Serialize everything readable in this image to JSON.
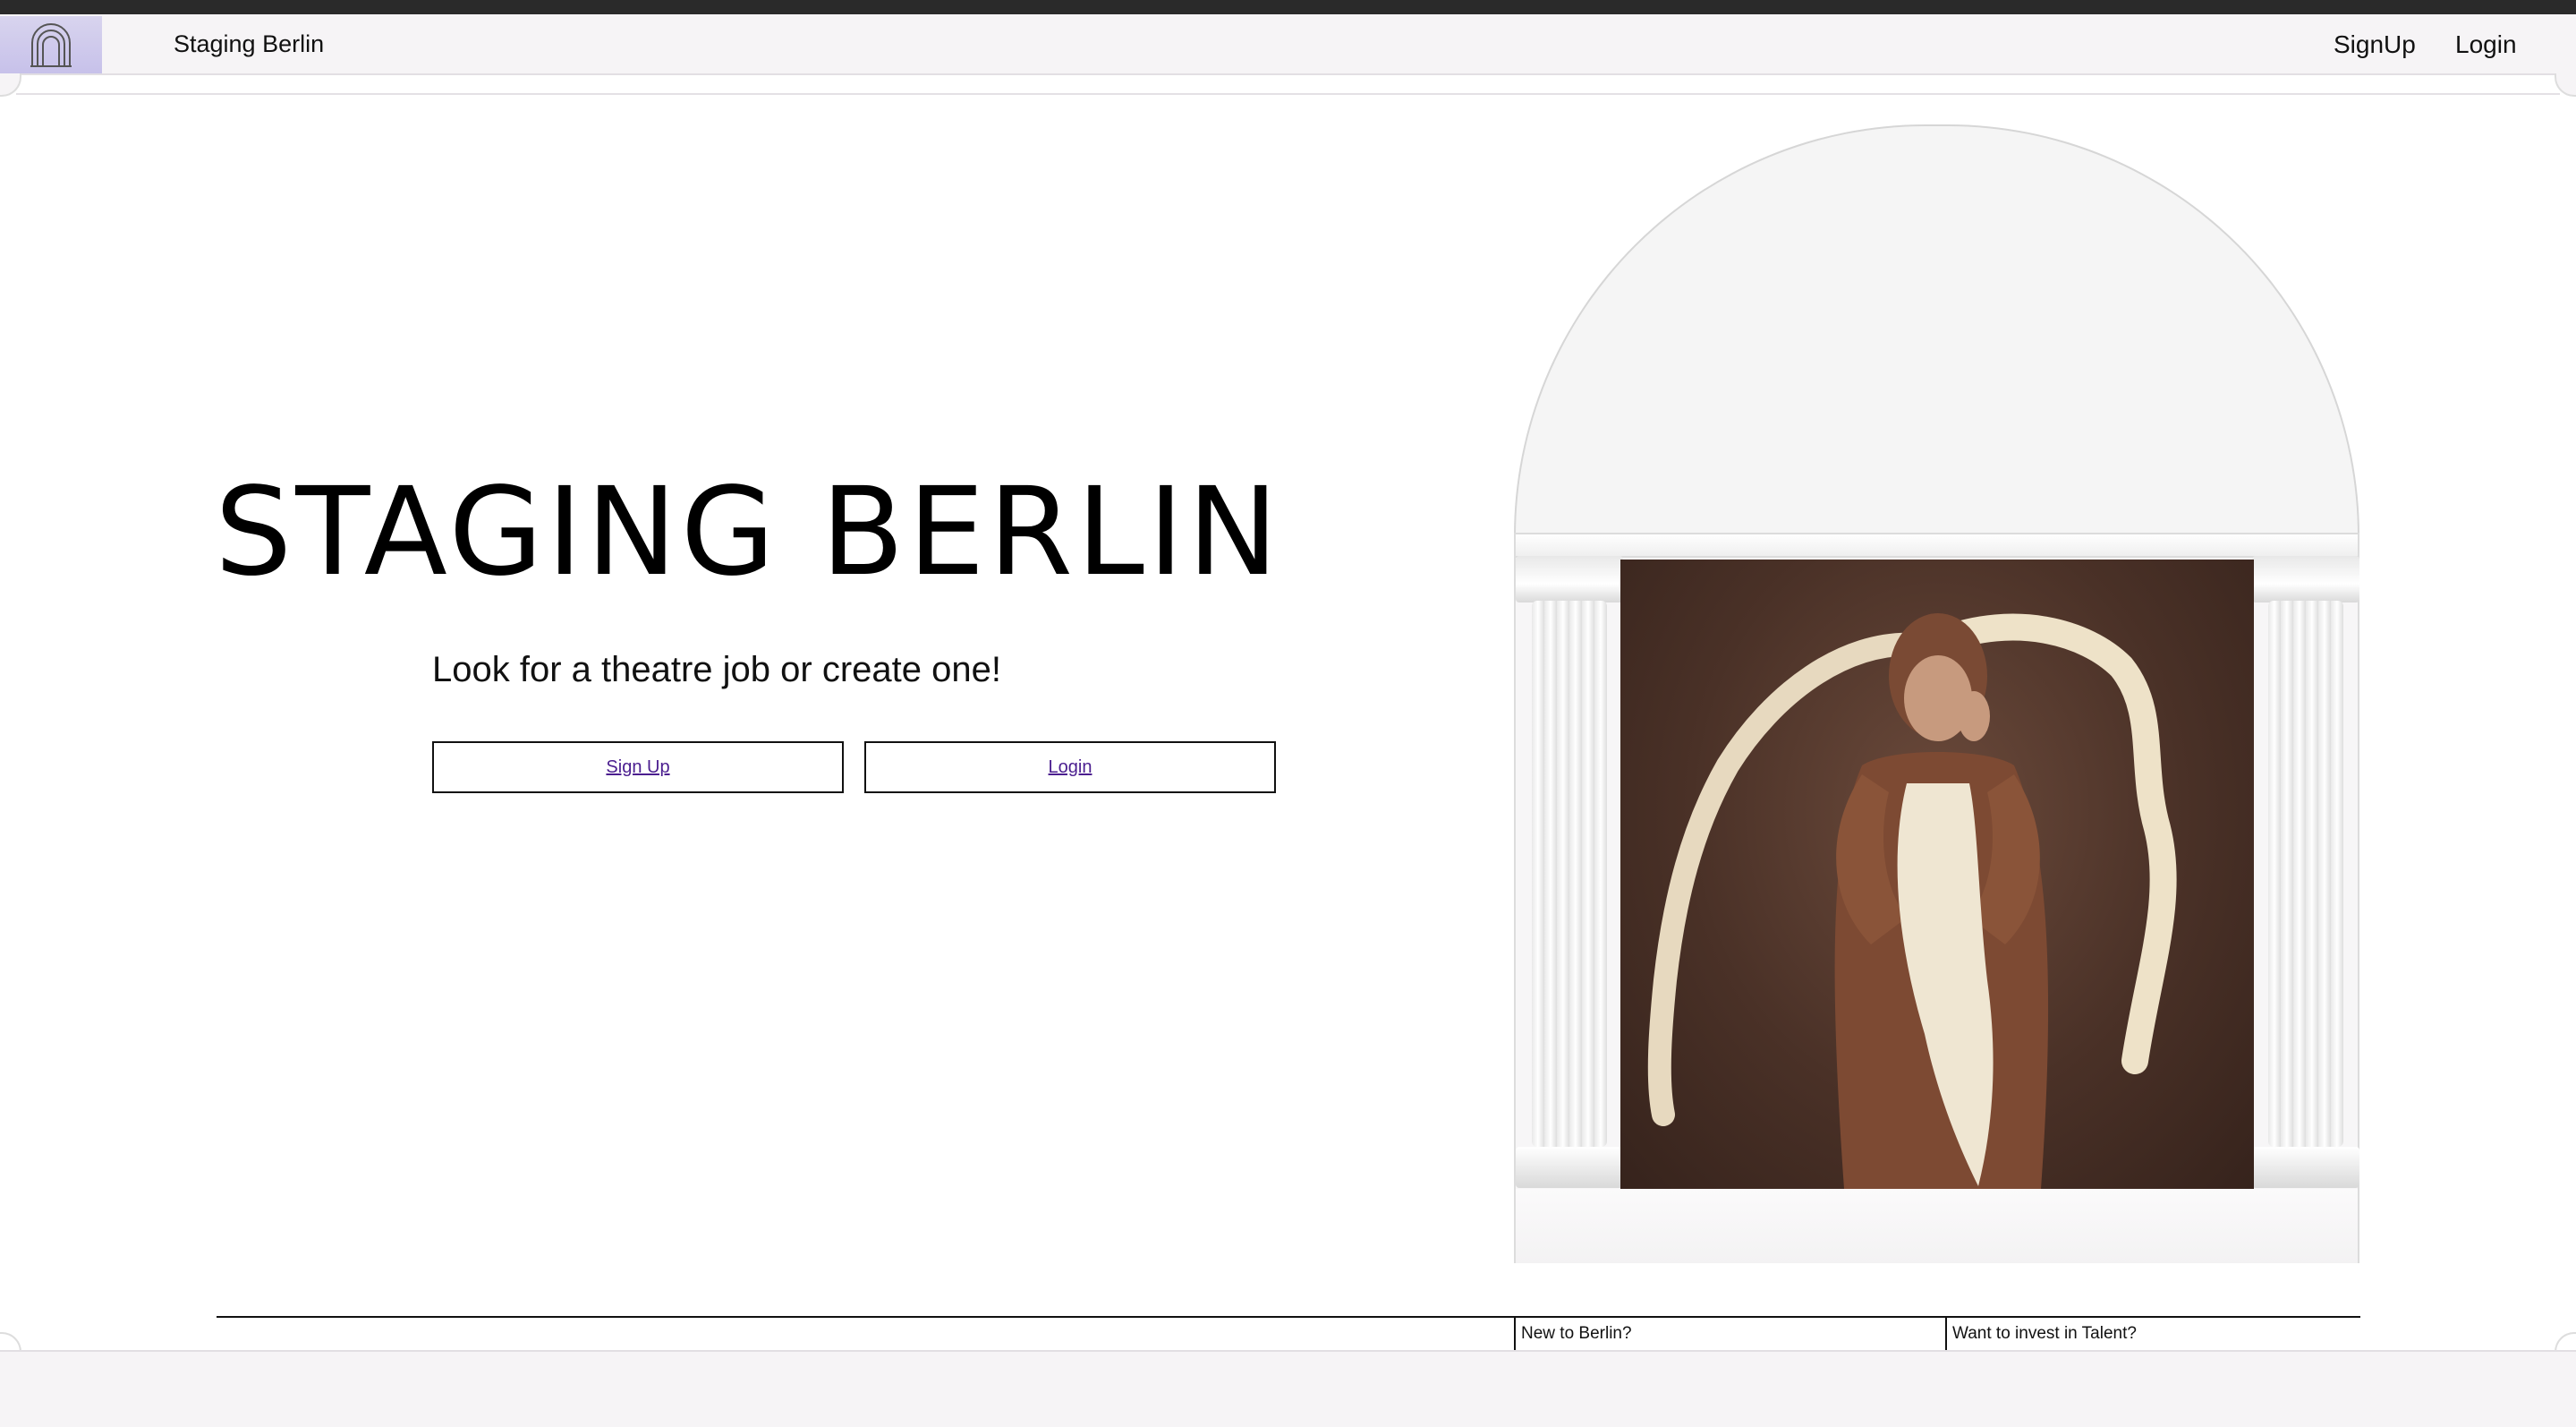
{
  "navbar": {
    "logo_icon": "arch-logo-icon",
    "site_name": "Staging Berlin",
    "signup_label": "SignUp",
    "login_label": "Login"
  },
  "hero": {
    "title": "STAGING BERLIN",
    "subtitle": "Look for a theatre job or create one!",
    "signup_button": "Sign Up",
    "login_button": "Login"
  },
  "footer": {
    "link_new": "New to Berlin?",
    "link_invest": "Want to invest in Talent?"
  },
  "colors": {
    "logo_bg": "#c7c1ea",
    "link_visited": "#4b1e8f",
    "navbar_bg": "#f6f4f6"
  }
}
